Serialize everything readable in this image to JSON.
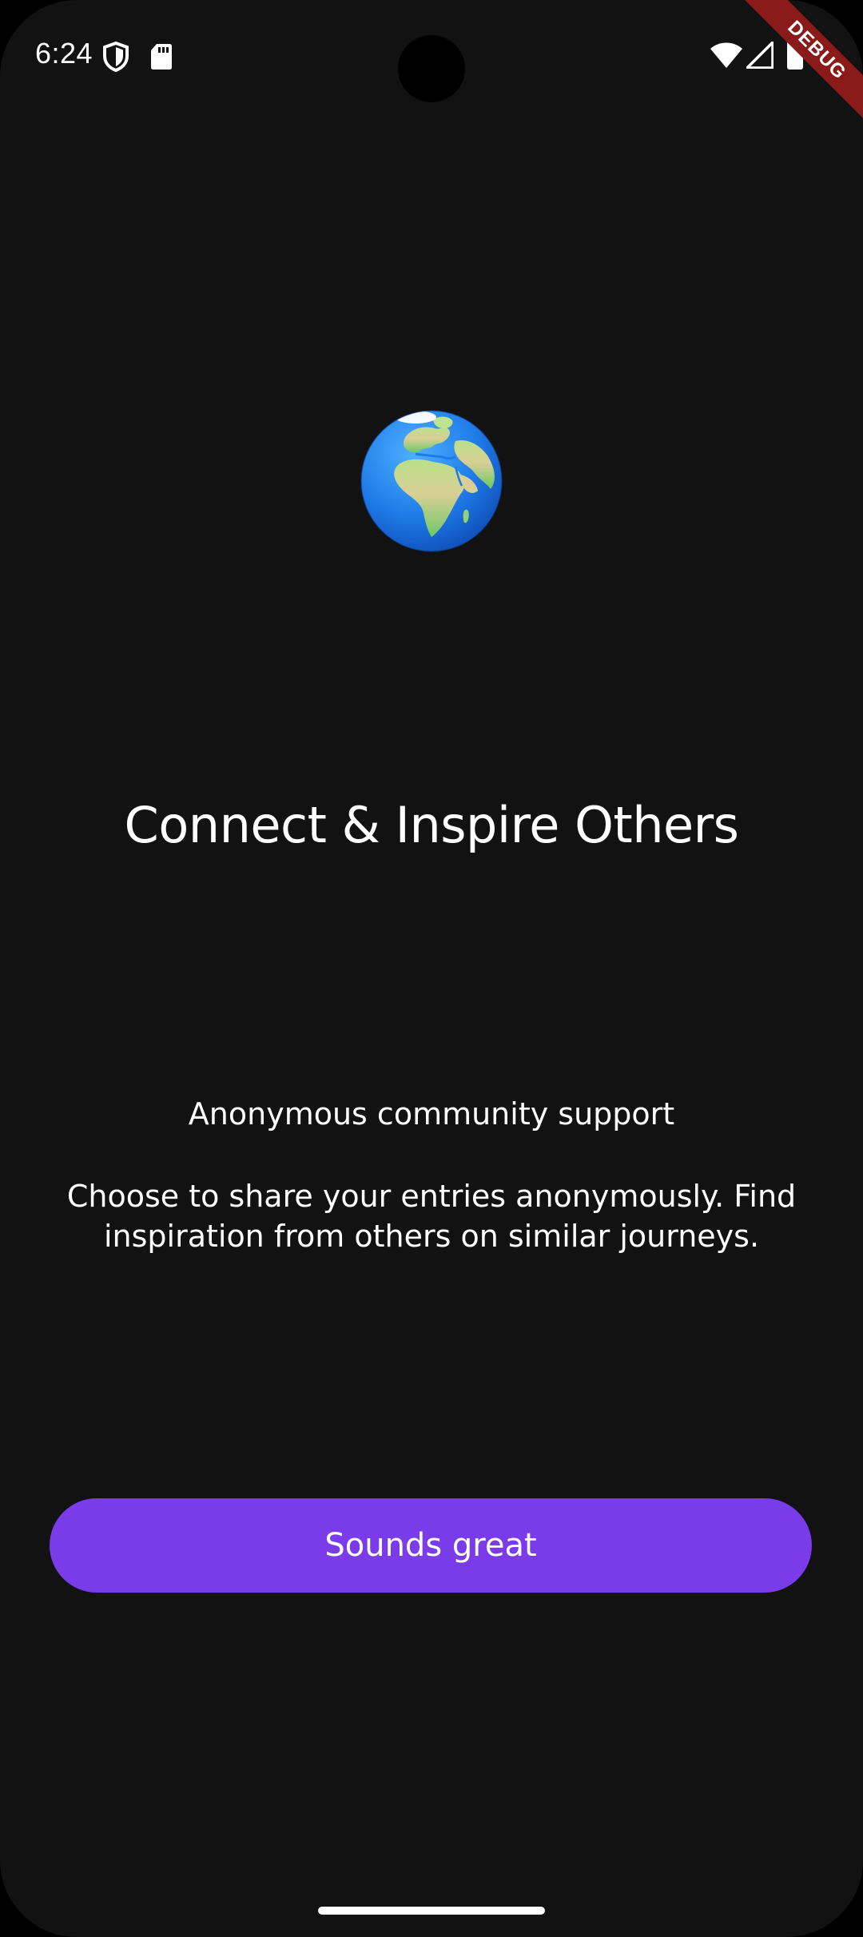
{
  "status_bar": {
    "time": "6:24",
    "icons": [
      "shield-icon",
      "sd-card-icon",
      "wifi-icon",
      "signal-icon",
      "battery-icon"
    ]
  },
  "debug_banner": {
    "label": "DEBUG"
  },
  "onboarding": {
    "illustration": "globe-europe-africa-icon",
    "title": "Connect & Inspire Others",
    "subtitle": "Anonymous community support",
    "description": "Choose to share your entries anonymously. Find inspiration from others on similar journeys.",
    "button_label": "Sounds great"
  },
  "colors": {
    "background": "#121212",
    "accent": "#7a3be8",
    "debug_banner": "#8b1a1a",
    "text": "#ffffff"
  }
}
